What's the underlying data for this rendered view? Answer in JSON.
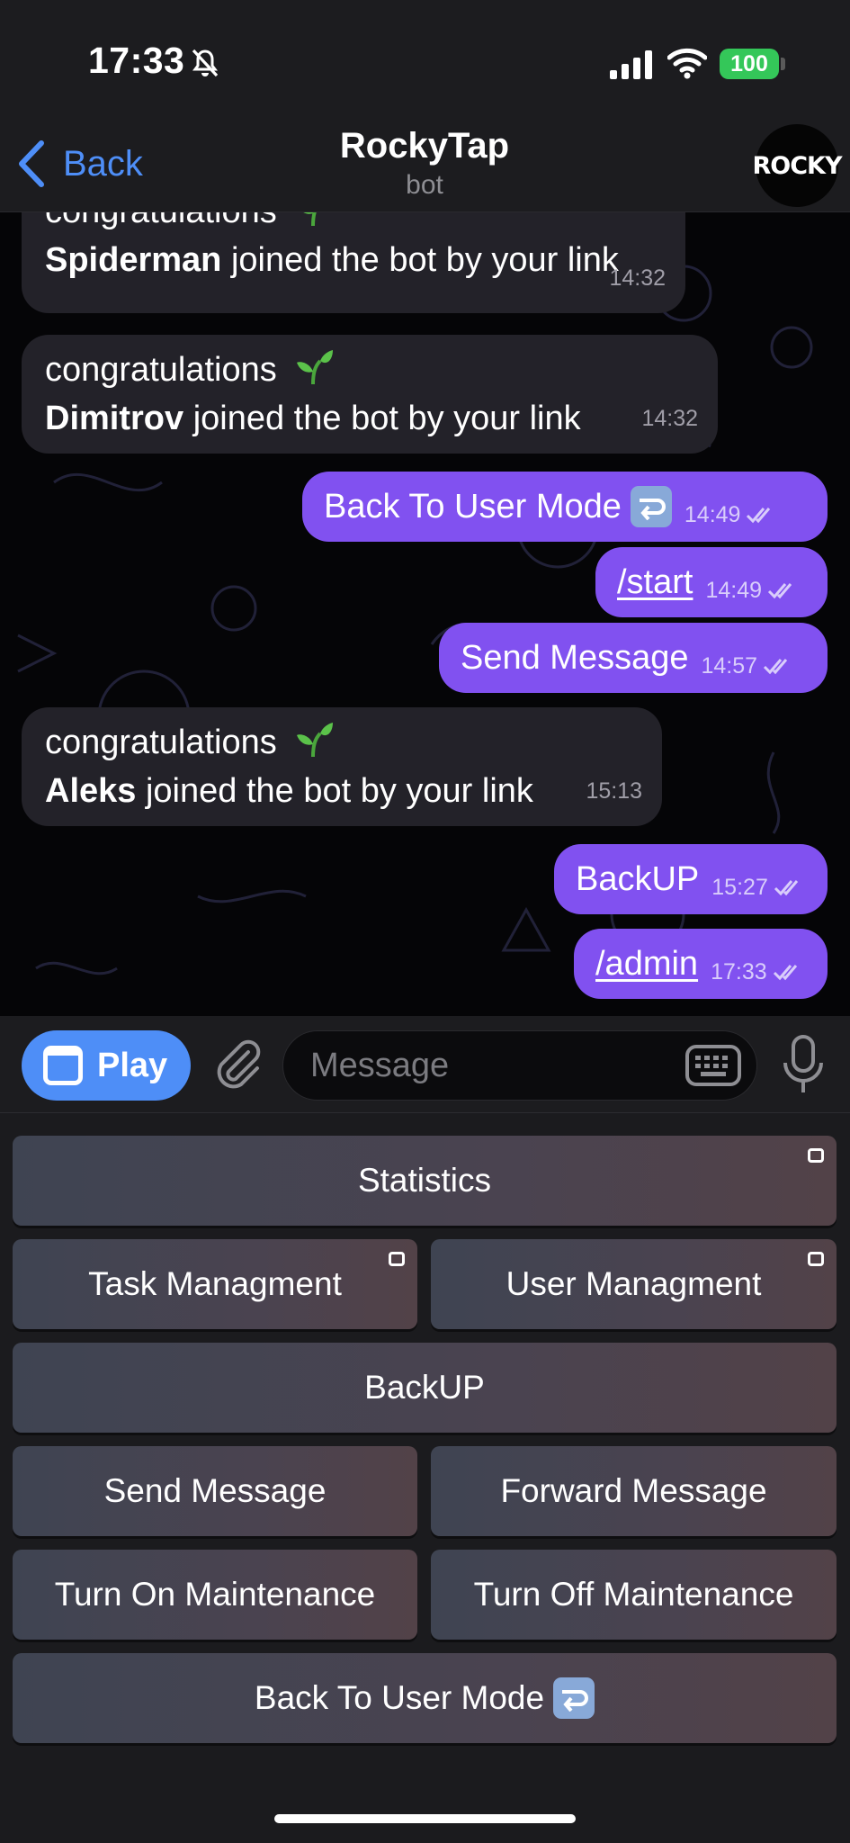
{
  "status": {
    "time": "17:33",
    "battery": "100"
  },
  "header": {
    "back_label": "Back",
    "title": "RockyTap",
    "subtitle": "bot",
    "avatar_text": "ROCKY"
  },
  "messages": [
    {
      "name": "Spiderman",
      "line1": "congratulations",
      "text": "joined the bot by your link",
      "time": "14:32"
    },
    {
      "name": "Dimitrov",
      "line1": "congratulations",
      "text": "joined the bot by your link",
      "time": "14:32"
    },
    {
      "text": "Back To User Mode",
      "time": "14:49"
    },
    {
      "text": "/start",
      "time": "14:49"
    },
    {
      "text": "Send Message",
      "time": "14:57"
    },
    {
      "name": "Aleks",
      "line1": "congratulations",
      "text": "joined the bot by your link",
      "time": "15:13"
    },
    {
      "text": "BackUP",
      "time": "15:27"
    },
    {
      "text": "/admin",
      "time": "17:33"
    }
  ],
  "input": {
    "play_label": "Play",
    "placeholder": "Message"
  },
  "keyboard": [
    "Statistics",
    "Task Managment",
    "User Managment",
    "BackUP",
    "Send Message",
    "Forward Message",
    "Turn On Maintenance",
    "Turn Off Maintenance",
    "Back To User Mode"
  ],
  "colors": {
    "accent": "#4e8ef7",
    "outgoing": "#8151f0",
    "incoming": "#232229",
    "battery": "#34c759"
  },
  "icons": [
    "bell-slash-icon",
    "signal-icon",
    "wifi-icon",
    "chevron-left-icon",
    "sprout-emoji-icon",
    "return-arrow-emoji-icon",
    "double-check-icon",
    "web-app-icon",
    "paperclip-icon",
    "keyboard-icon",
    "microphone-icon",
    "web-app-mini-icon"
  ]
}
